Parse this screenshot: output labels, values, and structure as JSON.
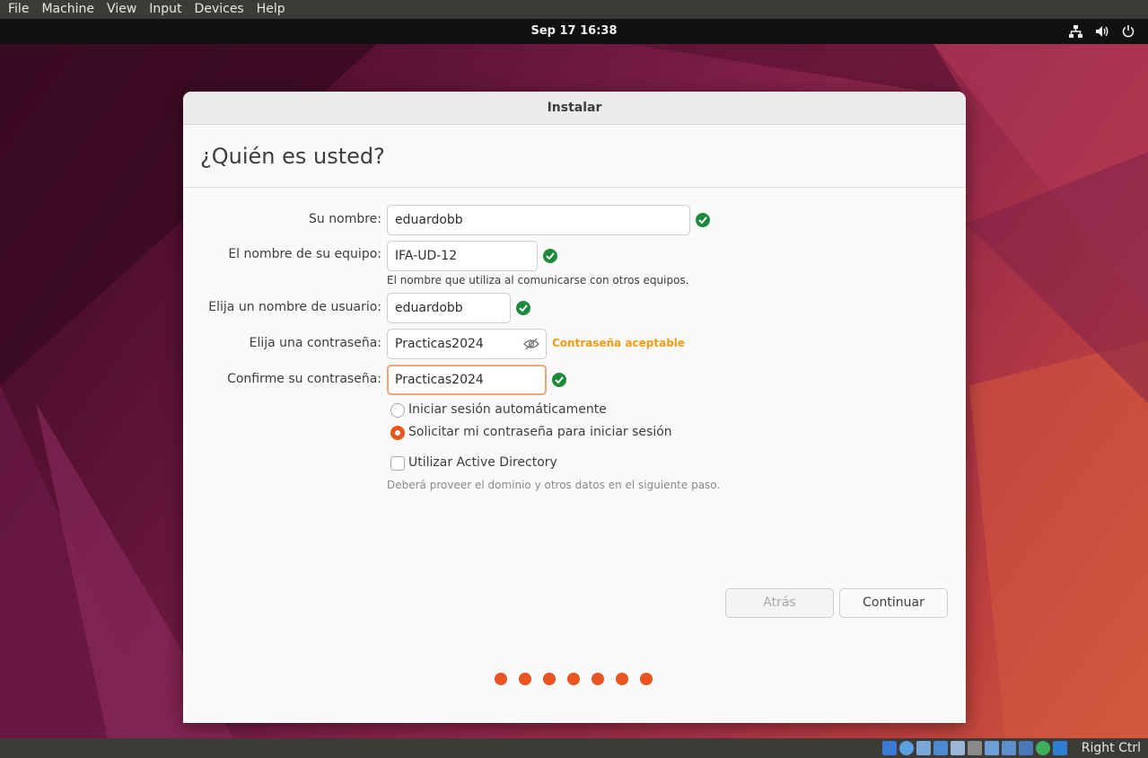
{
  "vbox_menu": [
    "File",
    "Machine",
    "View",
    "Input",
    "Devices",
    "Help"
  ],
  "topbar": {
    "clock": "Sep 17  16:38",
    "tray": [
      "network-icon",
      "volume-icon",
      "power-icon"
    ]
  },
  "window": {
    "title": "Instalar",
    "page_title": "¿Quién es usted?"
  },
  "form": {
    "name": {
      "label": "Su nombre:",
      "value": "eduardobb"
    },
    "computer": {
      "label": "El nombre de su equipo:",
      "value": "IFA-UD-12",
      "hint": "El nombre que utiliza al comunicarse con otros equipos."
    },
    "username": {
      "label": "Elija un nombre de usuario:",
      "value": "eduardobb"
    },
    "password": {
      "label": "Elija una contraseña:",
      "value": "Practicas2024",
      "strength": "Contraseña aceptable"
    },
    "confirm": {
      "label": "Confirme su contraseña:",
      "value": "Practicas2024"
    },
    "login_options": [
      {
        "label": "Iniciar sesión automáticamente",
        "selected": false
      },
      {
        "label": "Solicitar mi contraseña para iniciar sesión",
        "selected": true
      }
    ],
    "active_directory": {
      "label": "Utilizar Active Directory",
      "checked": false,
      "hint": "Deberá proveer el dominio y otros datos en el siguiente paso."
    }
  },
  "buttons": {
    "back": "Atrás",
    "continue": "Continuar"
  },
  "progress": {
    "steps": 7,
    "color": "#e95420"
  },
  "statusbar": {
    "host_key": "Right Ctrl"
  },
  "colors": {
    "accent": "#e95420",
    "valid": "#1c8a3a",
    "warning": "#f39c12"
  }
}
